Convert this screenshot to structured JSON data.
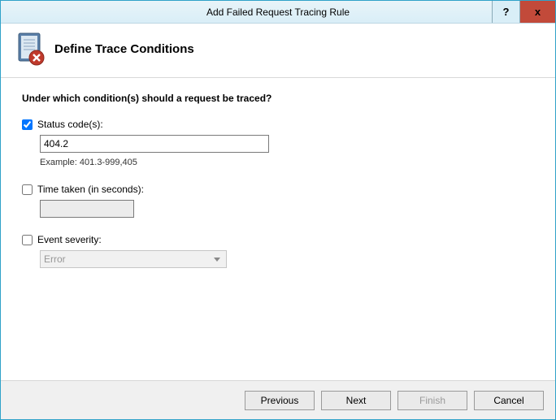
{
  "titlebar": {
    "title": "Add Failed Request Tracing Rule",
    "help": "?",
    "close": "x"
  },
  "header": {
    "title": "Define Trace Conditions"
  },
  "prompt": "Under which condition(s) should a request be traced?",
  "status_codes": {
    "label": "Status code(s):",
    "checked": true,
    "value": "404.2",
    "example": "Example: 401.3-999,405"
  },
  "time_taken": {
    "label": "Time taken (in seconds):",
    "checked": false,
    "value": ""
  },
  "event_severity": {
    "label": "Event severity:",
    "checked": false,
    "selected": "Error"
  },
  "buttons": {
    "previous": "Previous",
    "next": "Next",
    "finish": "Finish",
    "cancel": "Cancel"
  }
}
